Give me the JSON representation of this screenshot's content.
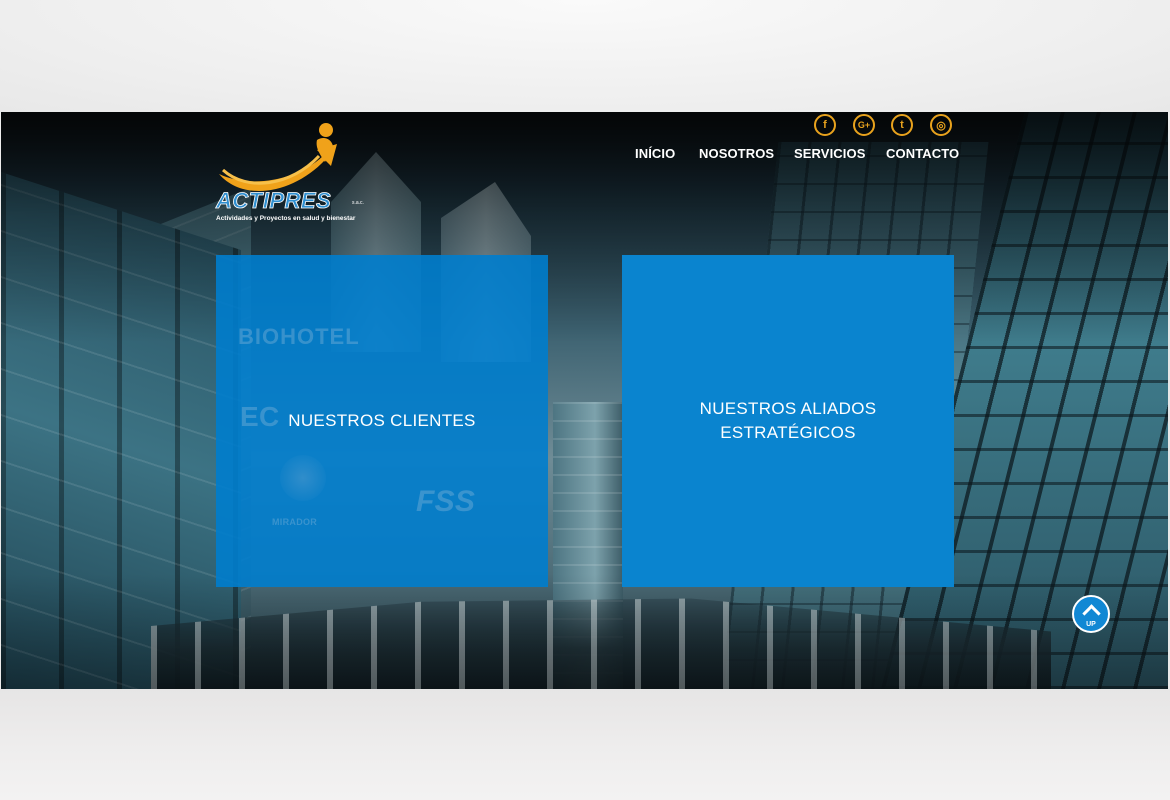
{
  "brand": {
    "name": "ACTIPRES",
    "suffix": "s.a.c.",
    "tagline": "Actividades y Proyectos en salud y bienestar",
    "primary_color": "#2f8fd0",
    "accent_color": "#e8a21d"
  },
  "social": [
    {
      "icon": "facebook-icon",
      "glyph": "f"
    },
    {
      "icon": "google-plus-icon",
      "glyph": "G+"
    },
    {
      "icon": "twitter-icon",
      "glyph": "t"
    },
    {
      "icon": "instagram-icon",
      "glyph": "◎"
    }
  ],
  "nav": {
    "items": [
      {
        "label": "INÍCIO"
      },
      {
        "label": "NOSOTROS"
      },
      {
        "label": "SERVICIOS"
      },
      {
        "label": "CONTACTO"
      }
    ]
  },
  "cards": {
    "clients": {
      "title": "NUESTROS CLIENTES",
      "logos": [
        "BIOHOTEL",
        "EC",
        "FSS",
        "MIRADOR"
      ],
      "color": "#007dcd"
    },
    "allies": {
      "title_line1": "NUESTROS ALIADOS",
      "title_line2": "ESTRATÉGICOS",
      "color": "#0a84cf"
    }
  },
  "up_button": {
    "label": "UP",
    "icon": "chevron-up-icon"
  }
}
